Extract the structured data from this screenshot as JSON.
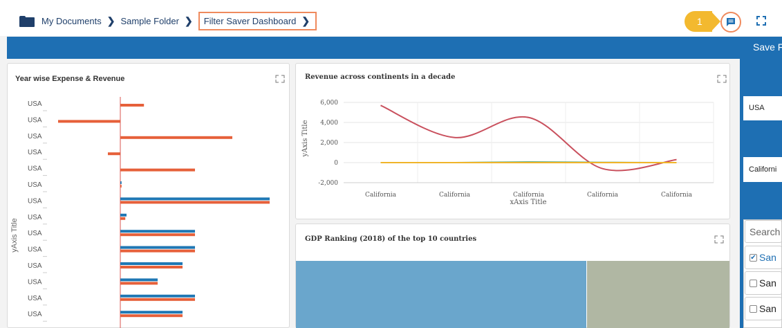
{
  "breadcrumb": {
    "items": [
      "My Documents",
      "Sample Folder",
      "Filter Saver Dashboard"
    ],
    "separator": "❯"
  },
  "callout": {
    "number": "1"
  },
  "toolbar": {
    "comment_icon": "comment-icon",
    "fullscreen_icon": "fullscreen-icon"
  },
  "ribbon": {
    "save_label": "Save F"
  },
  "filters": {
    "country_value": "USA",
    "state_value": "Californi",
    "search_placeholder": "Search",
    "list_items": [
      {
        "label": "San",
        "checked": true
      },
      {
        "label": "San",
        "checked": false
      },
      {
        "label": "San",
        "checked": false
      }
    ]
  },
  "colors": {
    "accent": "#1e6fb3",
    "highlight": "#ef8a5d",
    "callout": "#f3b92f",
    "series_blue": "#1f77b4",
    "series_orange": "#e6603a"
  },
  "chart_data": [
    {
      "type": "bar",
      "title": "Year wise Expense & Revenue",
      "ylabel": "yAxis Title",
      "orientation": "horizontal",
      "categories": [
        "USA",
        "USA",
        "USA",
        "USA",
        "USA",
        "USA",
        "USA",
        "USA",
        "USA",
        "USA",
        "USA",
        "USA",
        "USA",
        "USA"
      ],
      "series": [
        {
          "values": [
            0,
            0,
            0,
            0,
            0,
            1,
            120,
            5,
            60,
            60,
            50,
            30,
            60,
            50
          ]
        },
        {
          "values": [
            19,
            -50,
            90,
            -10,
            60,
            1,
            120,
            4,
            60,
            60,
            50,
            30,
            60,
            50
          ]
        }
      ]
    },
    {
      "type": "line",
      "title": "Revenue across continents in a decade",
      "xlabel": "xAxis Title",
      "ylabel": "yAxis Title",
      "categories": [
        "California",
        "California",
        "California",
        "California",
        "California"
      ],
      "yticks": [
        "6,000",
        "4,000",
        "2,000",
        "0",
        "-2,000"
      ],
      "ylim": [
        -2000,
        6000
      ],
      "series": [
        {
          "values": [
            5700,
            2500,
            4500,
            -600,
            300
          ]
        },
        {
          "values": [
            0,
            0,
            50,
            20,
            0
          ]
        },
        {
          "values": [
            0,
            0,
            0,
            0,
            0
          ]
        }
      ]
    },
    {
      "type": "treemap",
      "title": "GDP Ranking (2018) of the top 10 countries"
    }
  ]
}
